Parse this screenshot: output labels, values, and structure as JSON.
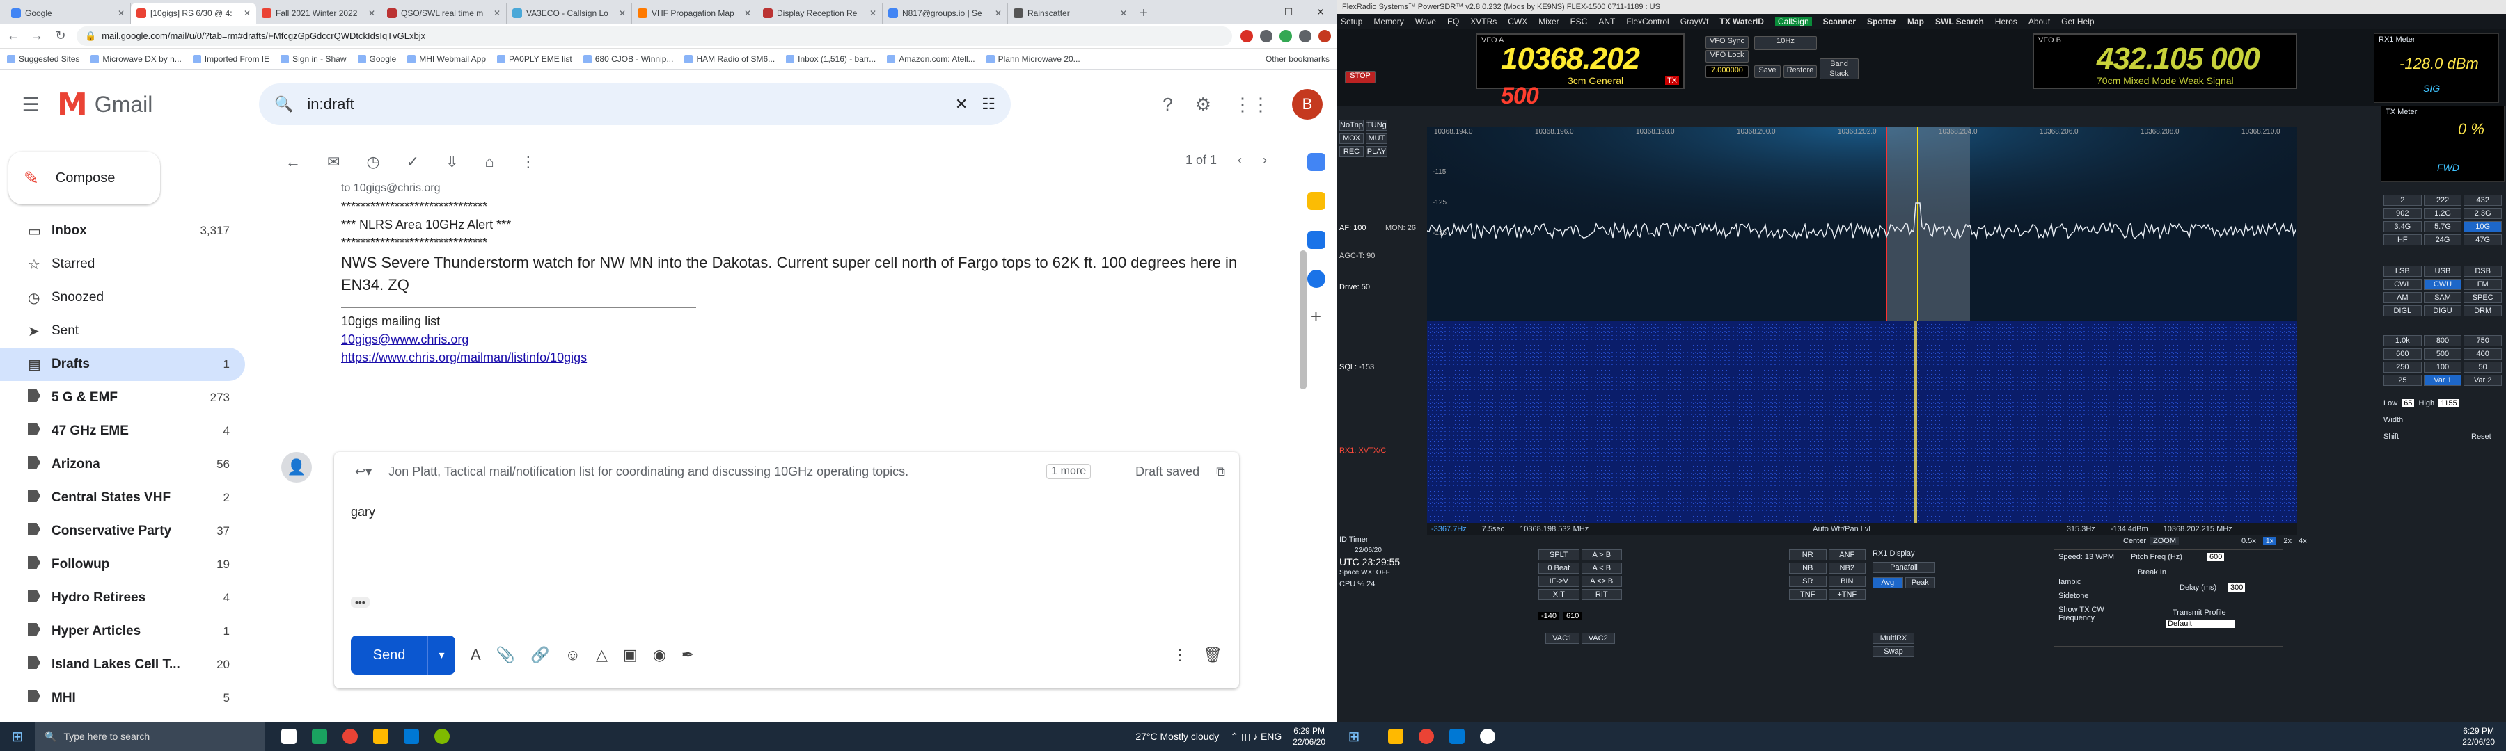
{
  "chrome": {
    "tabs": [
      {
        "title": "Google",
        "color": "#4285f4"
      },
      {
        "title": "[10gigs] RS 6/30 @ 4:",
        "color": "#ea4335",
        "active": true
      },
      {
        "title": "Fall 2021 Winter 2022",
        "color": "#ea4335"
      },
      {
        "title": "QSO/SWL real time m",
        "color": "#b33"
      },
      {
        "title": "VA3ECO - Callsign Lo",
        "color": "#4aa8d8"
      },
      {
        "title": "VHF Propagation Map",
        "color": "#ff7a00"
      },
      {
        "title": "Display Reception Re",
        "color": "#b33"
      },
      {
        "title": "N817@groups.io | Se",
        "color": "#4285f4"
      },
      {
        "title": "Rainscatter",
        "color": "#555"
      }
    ],
    "url": "mail.google.com/mail/u/0/?tab=rm#drafts/FMfcgzGpGdccrQWDtckIdsIqTvGLxbjx",
    "bookmarks": [
      "Suggested Sites",
      "Microwave DX by n...",
      "Imported From IE",
      "Sign in - Shaw",
      "Google",
      "MHI Webmail App",
      "PA0PLY EME list",
      "680 CJOB - Winnip...",
      "HAM Radio of SM6...",
      "Inbox (1,516) - barr...",
      "Amazon.com: Atell...",
      "Plann Microwave 20..."
    ],
    "other_bookmarks": "Other bookmarks"
  },
  "gmail": {
    "brand": "Gmail",
    "search_query": "in:draft",
    "avatar_letter": "B",
    "compose_label": "Compose",
    "nav": [
      {
        "label": "Inbox",
        "count": "3,317",
        "icon": "inbox-icon"
      },
      {
        "label": "Starred",
        "count": "",
        "icon": "star-icon"
      },
      {
        "label": "Snoozed",
        "count": "",
        "icon": "clock-icon"
      },
      {
        "label": "Sent",
        "count": "",
        "icon": "send-icon"
      },
      {
        "label": "Drafts",
        "count": "1",
        "icon": "draft-icon",
        "active": true
      },
      {
        "label": "5 G & EMF",
        "count": "273"
      },
      {
        "label": "47 GHz EME",
        "count": "4"
      },
      {
        "label": "Arizona",
        "count": "56"
      },
      {
        "label": "Central States VHF",
        "count": "2"
      },
      {
        "label": "Conservative Party",
        "count": "37"
      },
      {
        "label": "Followup",
        "count": "19"
      },
      {
        "label": "Hydro Retirees",
        "count": "4"
      },
      {
        "label": "Hyper Articles",
        "count": "1"
      },
      {
        "label": "Island Lakes Cell T...",
        "count": "20"
      },
      {
        "label": "MHI",
        "count": "5"
      }
    ],
    "pager": "1 of 1",
    "message": {
      "to_line": "to 10gigs@chris.org",
      "stars1": "******************************",
      "alert": "*** NLRS Area 10GHz Alert ***",
      "stars2": "******************************",
      "body": "NWS Severe Thunderstorm watch for NW MN into the Dakotas.  Current super cell north of Fargo tops to 62K ft.   100 degrees here in EN34.  ZQ",
      "list_name": "10gigs mailing list",
      "list_email": "10gigs@www.chris.org",
      "list_url": "https://www.chris.org/mailman/listinfo/10gigs"
    },
    "reply": {
      "to": "Jon Platt, Tactical mail/notification list for coordinating and discussing 10GHz operating topics.",
      "more": "1 more",
      "status": "Draft saved",
      "body": "gary",
      "send": "Send"
    }
  },
  "taskbar_left": {
    "search_placeholder": "Type here to search",
    "weather": "27°C  Mostly cloudy",
    "time": "6:29 PM",
    "date": "22/06/20"
  },
  "sdr": {
    "title": "FlexRadio Systems™ PowerSDR™ v2.8.0.232 (Mods by KE9NS)  FLEX-1500 0711-1189 : US",
    "menu": [
      "Setup",
      "Memory",
      "Wave",
      "EQ",
      "XVTRs",
      "CWX",
      "Mixer",
      "ESC",
      "ANT",
      "FlexControl",
      "GrayWf",
      "TX WaterID",
      "CallSign",
      "Scanner",
      "Spotter",
      "Map",
      "SWL Search",
      "Heros",
      "About",
      "Get Help"
    ],
    "vfoA": {
      "label": "VFO A",
      "freq_main": "10368.202",
      "freq_sub": "500",
      "mode": "3cm General",
      "tx": "TX"
    },
    "vfoB": {
      "label": "VFO B",
      "freq_main": "432.105",
      "freq_sub": "000",
      "mode": "70cm Mixed Mode Weak Signal"
    },
    "vfo_sync": "VFO Sync",
    "vfo_lock": "VFO Lock",
    "tune_step": "10Hz",
    "step_val": "7.000000",
    "save": "Save",
    "restore": "Restore",
    "band_stack": "Band Stack",
    "rx1_meter": "RX1 Meter",
    "rx1_meter_val": "-128.0 dBm",
    "tx_meter": "TX Meter",
    "tx_meter_val": "0 %",
    "sig": "SIG",
    "fwd": "FWD",
    "stop": "STOP",
    "freq_labels": [
      "10368.194.0",
      "10368.196.0",
      "10368.198.0",
      "10368.200.0",
      "10368.202.0",
      "10368.204.0",
      "10368.206.0",
      "10368.208.0",
      "10368.210.0"
    ],
    "db_labels": [
      "-115",
      "-125",
      "-135"
    ],
    "modes": [
      "LSB",
      "USB",
      "DSB",
      "CWL",
      "CWU",
      "FM",
      "AM",
      "SAM",
      "SPEC",
      "DIGL",
      "DIGU",
      "DRM"
    ],
    "filters": [
      "1.0k",
      "800",
      "750",
      "600",
      "500",
      "400",
      "250",
      "100",
      "50",
      "25",
      "Var 1",
      "Var 2"
    ],
    "bands": [
      "2",
      "222",
      "432",
      "902",
      "1.2G",
      "2.3G",
      "3.4G",
      "5.7G",
      "10G",
      "HF",
      "24G",
      "47G"
    ],
    "status": {
      "left_freq": "-3367.7Hz",
      "scale": "7.5sec",
      "center_freq": "10368.198.532 MHz",
      "pan": "Auto Wtr/Pan Lvl",
      "bw": "315.3Hz",
      "dbm": "-134.4dBm",
      "right_freq": "10368.202.215 MHz"
    },
    "agc": "AGC-T: 90",
    "drive": "Drive: 50",
    "af": "AF: 100",
    "mon": "MON: 26",
    "sql": "SQL: -153",
    "id_timer": "ID Timer",
    "utc_date": "22/06/20",
    "utc_time": "UTC  23:29:55",
    "space_wx": "Space WX: OFF",
    "cpu": "CPU %",
    "cpu_val": "24",
    "rx1_display": "RX1 Display",
    "display_mode": "Panafall",
    "avg": "Avg",
    "peak": "Peak",
    "speed": "Speed: 13 WPM",
    "pitch": "Pitch Freq (Hz)",
    "pitch_val": "600",
    "break_in": "Break In",
    "delay": "Delay (ms)",
    "delay_val": "300",
    "iambic": "Iambic",
    "sidetone": "Sidetone",
    "show_cw": "Show TX CW Frequency",
    "transmit_profile": "Transmit Profile",
    "profile_val": "Default",
    "center": "Center",
    "zoom": "ZOOM",
    "zoom_vals": [
      "0.5x",
      "1x",
      "2x",
      "4x"
    ],
    "low": "Low",
    "low_val": "65",
    "high": "High",
    "high_val": "1155",
    "width": "Width",
    "shift": "Shift",
    "reset": "Reset",
    "rx_rx": "RX1: XVTX/C",
    "buttons_left": [
      "NoTnp",
      "TUNg",
      "MOX",
      "MUT",
      "REC",
      "PLAY"
    ],
    "nr": [
      "NR",
      "ANF",
      "NB",
      "NB2",
      "SR",
      "BIN",
      "TNF",
      "+TNF"
    ],
    "split": [
      "SPLT",
      "A > B",
      "0 Beat",
      "A < B",
      "IF->V",
      "A <> B",
      "XIT",
      "RIT"
    ],
    "xit_val": "-140",
    "rit_val": "610",
    "vac1": "VAC1",
    "vac2": "VAC2",
    "multi_rx": "MultiRX",
    "swap": "Swap"
  },
  "taskbar_right": {
    "time": "6:29 PM",
    "date": "22/06/20"
  }
}
